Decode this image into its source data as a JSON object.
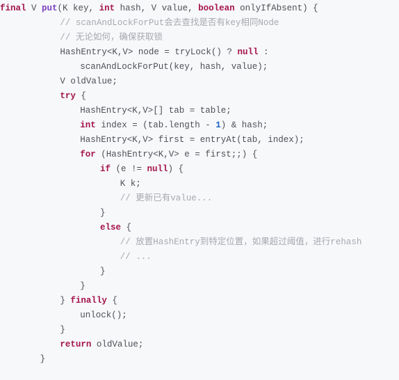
{
  "editor": {
    "language": "java",
    "background_color": "#f7f8fa",
    "line_count": 22,
    "theme": {
      "keyword_color": "#a4144b",
      "function_color": "#7b3fbf",
      "comment_color": "#a8a8b0",
      "number_color": "#1f63c4",
      "text_color": "#4f4f57"
    }
  },
  "code": {
    "lines": [
      {
        "indent": 0,
        "tokens": [
          {
            "t": "final",
            "c": "kw"
          },
          {
            "t": " V ",
            "c": "plain"
          },
          {
            "t": "put",
            "c": "fn"
          },
          {
            "t": "(K key, ",
            "c": "plain"
          },
          {
            "t": "int",
            "c": "kw"
          },
          {
            "t": " hash, V value, ",
            "c": "plain"
          },
          {
            "t": "boolean",
            "c": "kw"
          },
          {
            "t": " onlyIfAbsent) {",
            "c": "plain"
          }
        ]
      },
      {
        "indent": 12,
        "tokens": [
          {
            "t": "// scanAndLockForPut会去查找是否有key相同Node",
            "c": "cmt"
          }
        ]
      },
      {
        "indent": 12,
        "tokens": [
          {
            "t": "// 无论如何，确保获取锁",
            "c": "cmt"
          }
        ]
      },
      {
        "indent": 12,
        "tokens": [
          {
            "t": "HashEntry<K,V> node = tryLock() ? ",
            "c": "plain"
          },
          {
            "t": "null",
            "c": "kw"
          },
          {
            "t": " :",
            "c": "plain"
          }
        ]
      },
      {
        "indent": 16,
        "tokens": [
          {
            "t": "scanAndLockForPut(key, hash, value);",
            "c": "plain"
          }
        ]
      },
      {
        "indent": 12,
        "tokens": [
          {
            "t": "V oldValue;",
            "c": "plain"
          }
        ]
      },
      {
        "indent": 12,
        "tokens": [
          {
            "t": "try",
            "c": "kw"
          },
          {
            "t": " {",
            "c": "plain"
          }
        ]
      },
      {
        "indent": 16,
        "tokens": [
          {
            "t": "HashEntry<K,V>[] tab = table;",
            "c": "plain"
          }
        ]
      },
      {
        "indent": 16,
        "tokens": [
          {
            "t": "int",
            "c": "kw"
          },
          {
            "t": " index = (tab.length - ",
            "c": "plain"
          },
          {
            "t": "1",
            "c": "num"
          },
          {
            "t": ") & hash;",
            "c": "plain"
          }
        ]
      },
      {
        "indent": 16,
        "tokens": [
          {
            "t": "HashEntry<K,V> first = entryAt(tab, index);",
            "c": "plain"
          }
        ]
      },
      {
        "indent": 16,
        "tokens": [
          {
            "t": "for",
            "c": "kw"
          },
          {
            "t": " (HashEntry<K,V> e = first;;) {",
            "c": "plain"
          }
        ]
      },
      {
        "indent": 20,
        "tokens": [
          {
            "t": "if",
            "c": "kw"
          },
          {
            "t": " (e != ",
            "c": "plain"
          },
          {
            "t": "null",
            "c": "kw"
          },
          {
            "t": ") {",
            "c": "plain"
          }
        ]
      },
      {
        "indent": 24,
        "tokens": [
          {
            "t": "K k;",
            "c": "plain"
          }
        ]
      },
      {
        "indent": 24,
        "tokens": [
          {
            "t": "// 更新已有value...",
            "c": "cmt"
          }
        ]
      },
      {
        "indent": 20,
        "tokens": [
          {
            "t": "}",
            "c": "plain"
          }
        ]
      },
      {
        "indent": 20,
        "tokens": [
          {
            "t": "else",
            "c": "kw"
          },
          {
            "t": " {",
            "c": "plain"
          }
        ]
      },
      {
        "indent": 24,
        "tokens": [
          {
            "t": "// 放置HashEntry到特定位置，如果超过阈值，进行rehash",
            "c": "cmt"
          }
        ]
      },
      {
        "indent": 24,
        "tokens": [
          {
            "t": "// ...",
            "c": "cmt"
          }
        ]
      },
      {
        "indent": 20,
        "tokens": [
          {
            "t": "}",
            "c": "plain"
          }
        ]
      },
      {
        "indent": 16,
        "tokens": [
          {
            "t": "}",
            "c": "plain"
          }
        ]
      },
      {
        "indent": 12,
        "tokens": [
          {
            "t": "} ",
            "c": "plain"
          },
          {
            "t": "finally",
            "c": "kw"
          },
          {
            "t": " {",
            "c": "plain"
          }
        ]
      },
      {
        "indent": 16,
        "tokens": [
          {
            "t": "unlock();",
            "c": "plain"
          }
        ]
      },
      {
        "indent": 12,
        "tokens": [
          {
            "t": "}",
            "c": "plain"
          }
        ]
      },
      {
        "indent": 12,
        "tokens": [
          {
            "t": "return",
            "c": "kw"
          },
          {
            "t": " oldValue;",
            "c": "plain"
          }
        ]
      },
      {
        "indent": 8,
        "tokens": [
          {
            "t": "}",
            "c": "plain"
          }
        ]
      }
    ]
  }
}
